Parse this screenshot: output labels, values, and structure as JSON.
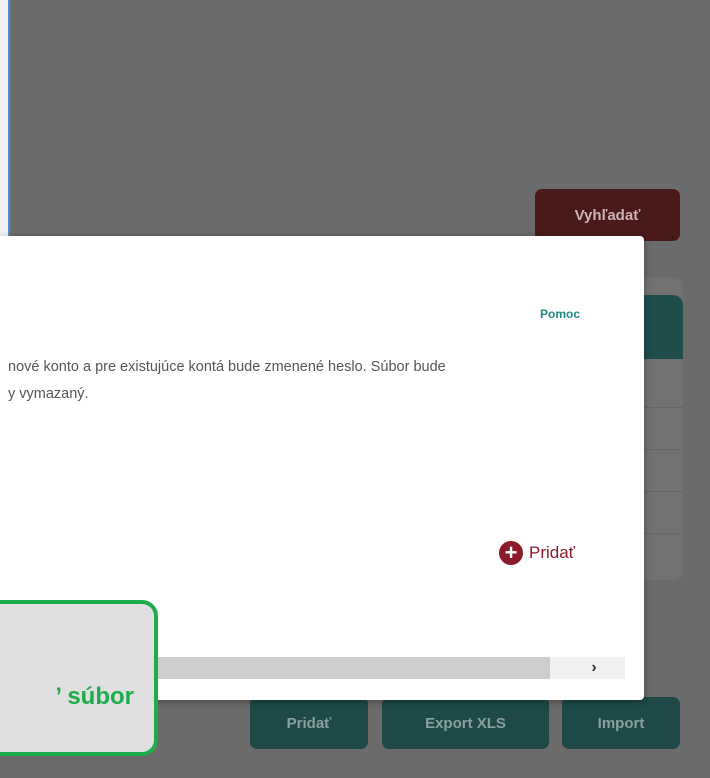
{
  "background": {
    "search_button": "Vyhľadať",
    "bottom_buttons": {
      "add": "Pridať",
      "export": "Export XLS",
      "import": "Import"
    }
  },
  "modal": {
    "help_link": "Pomoc",
    "description_line1": "nové konto a pre existujúce kontá bude zmenené heslo. Súbor bude",
    "description_line2": "y vymazaný.",
    "add_label": "Pridať",
    "scroll_right": "›"
  },
  "callout": {
    "text": "’ súbor"
  },
  "colors": {
    "accent_teal": "#1f8a83",
    "accent_red": "#8b1a2b",
    "callout_green": "#1fad4b"
  }
}
